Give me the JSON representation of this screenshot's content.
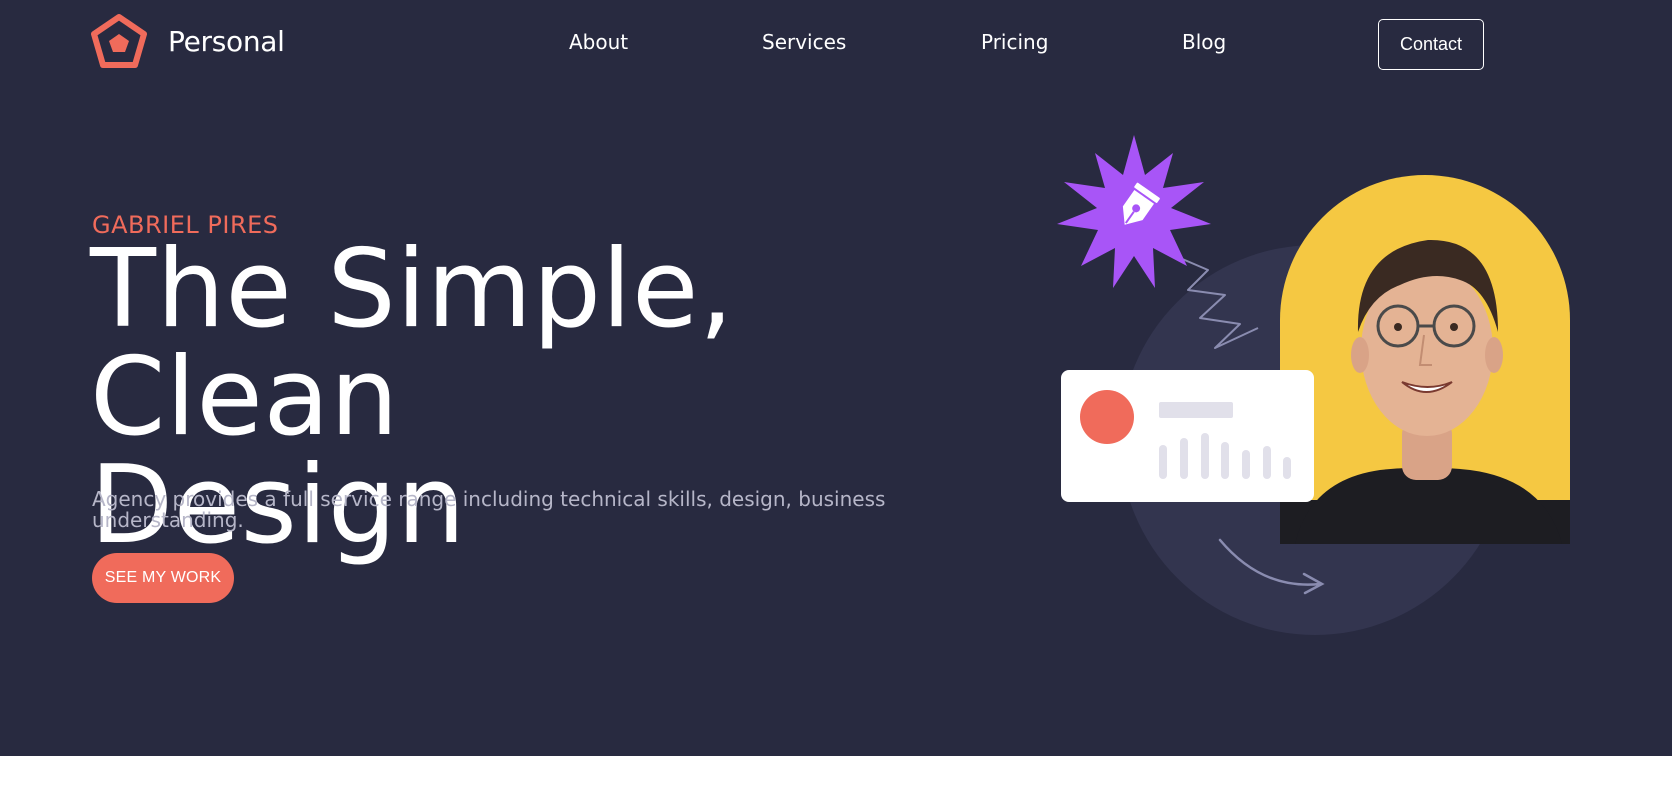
{
  "header": {
    "brand": "Personal",
    "nav": [
      {
        "label": "About"
      },
      {
        "label": "Services"
      },
      {
        "label": "Pricing"
      },
      {
        "label": "Blog"
      }
    ],
    "contact_label": "Contact"
  },
  "hero": {
    "eyebrow": "GABRIEL PIRES",
    "headline_line1": "The Simple, Clean",
    "headline_line2": "Design",
    "subtitle": "Agency provides a full service range including technical skills, design, business understanding.",
    "cta_label": "SEE MY WORK"
  },
  "colors": {
    "background": "#282a40",
    "accent": "#f06b5b",
    "purple": "#a855f7",
    "yellow": "#f5c842",
    "text": "#ffffff",
    "muted_text": "#b6b6c8"
  },
  "icons": {
    "logo": "pentagon-logo-icon",
    "badge": "pen-nib-icon"
  }
}
